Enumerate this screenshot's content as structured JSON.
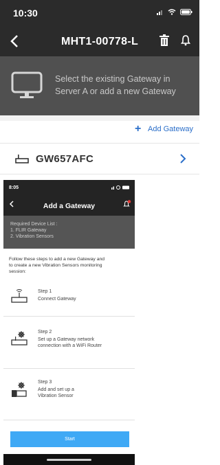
{
  "screen1": {
    "status_time": "10:30",
    "title": "MHT1-00778-L",
    "banner_line1": "Select the existing Gateway in",
    "banner_line2": "Server A or add a new Gateway",
    "add_gateway_label": "Add Gateway",
    "gateway_name": "GW657AFC",
    "icons": [
      "back-chevron-icon",
      "trash-icon",
      "bell-icon",
      "monitor-icon",
      "plus-icon",
      "router-icon",
      "chevron-right-icon"
    ],
    "colors": {
      "header": "#2b2b2b",
      "banner": "#505050",
      "accent": "#2a6ec9"
    }
  },
  "screen2": {
    "status_time": "8:05",
    "title": "Add a Gateway",
    "device_list": {
      "heading": "Required Device List :",
      "item1": "1. FLIR Gateway",
      "item2": "2. Vibration Sensors"
    },
    "intro_line1": "Follow these steps to add a new Gateway and",
    "intro_line2": "to create a new Vibration Sensors monitoring",
    "intro_line3": "session:",
    "steps": [
      {
        "title": "Step 1",
        "desc_line1": "Connect Gateway",
        "desc_line2": ""
      },
      {
        "title": "Step 2",
        "desc_line1": "Set up a Gateway network",
        "desc_line2": "connection with a WiFi Router"
      },
      {
        "title": "Step 3",
        "desc_line1": "Add and set up a",
        "desc_line2": "Vibration Sensor"
      }
    ],
    "start_label": "Start",
    "colors": {
      "start_button": "#3fa9f5",
      "notification_dot": "#e53935"
    }
  }
}
